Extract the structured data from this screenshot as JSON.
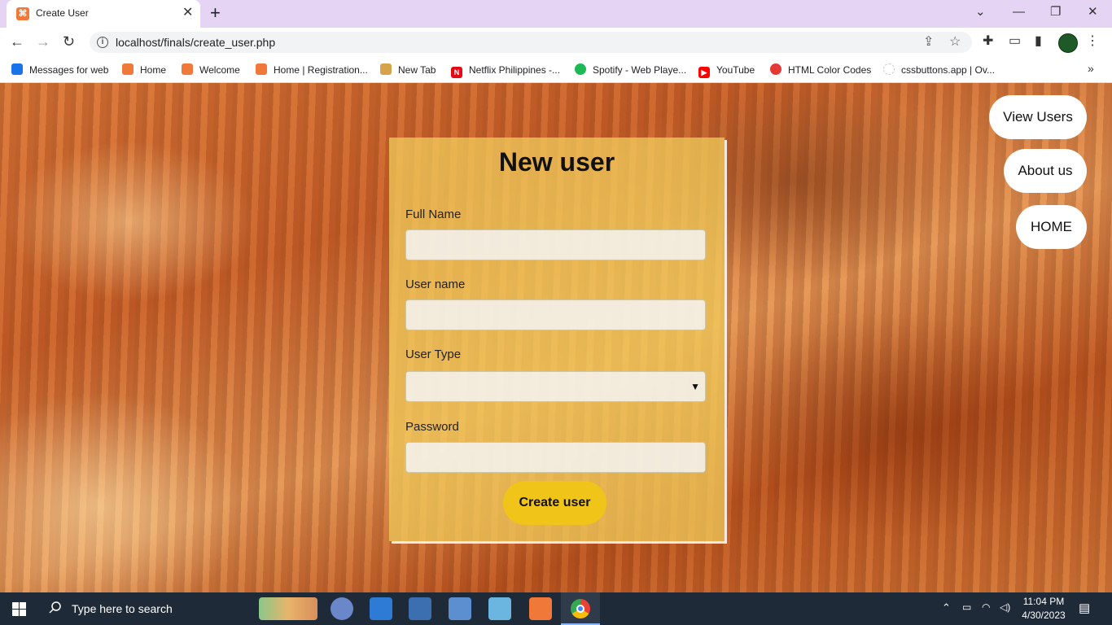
{
  "browser": {
    "tab_title": "Create User",
    "url": "localhost/finals/create_user.php"
  },
  "bookmarks": [
    {
      "label": "Messages for web",
      "icon": "messages-icon",
      "color": "#1a73e8"
    },
    {
      "label": "Home",
      "icon": "xampp-icon",
      "color": "#f07838"
    },
    {
      "label": "Welcome",
      "icon": "xampp-icon",
      "color": "#f07838"
    },
    {
      "label": "Home | Registration...",
      "icon": "xampp-icon",
      "color": "#f07838"
    },
    {
      "label": "New Tab",
      "icon": "pizza-icon",
      "color": "#d6a34a"
    },
    {
      "label": "Netflix Philippines -...",
      "icon": "netflix-icon",
      "color": "#e50914"
    },
    {
      "label": "Spotify - Web Playe...",
      "icon": "spotify-icon",
      "color": "#1db954"
    },
    {
      "label": "YouTube",
      "icon": "youtube-icon",
      "color": "#ff0000"
    },
    {
      "label": "HTML Color Codes",
      "icon": "color-icon",
      "color": "#e53935"
    },
    {
      "label": "cssbuttons.app | Ov...",
      "icon": "loading-icon",
      "color": "#cccccc"
    }
  ],
  "form": {
    "title": "New user",
    "full_name_label": "Full Name",
    "full_name_value": "",
    "username_label": "User name",
    "username_value": "",
    "user_type_label": "User Type",
    "user_type_value": "",
    "password_label": "Password",
    "password_value": "",
    "submit_label": "Create user"
  },
  "nav": {
    "view_users": "View Users",
    "about_us": "About us",
    "home": "HOME"
  },
  "taskbar": {
    "search_placeholder": "Type here to search",
    "time": "11:04 PM",
    "date": "4/30/2023"
  },
  "colors": {
    "card_bg": "#f0c85a",
    "button": "#f0c418",
    "tabstrip": "#e6d4f5",
    "taskbar": "#1f2a38"
  }
}
